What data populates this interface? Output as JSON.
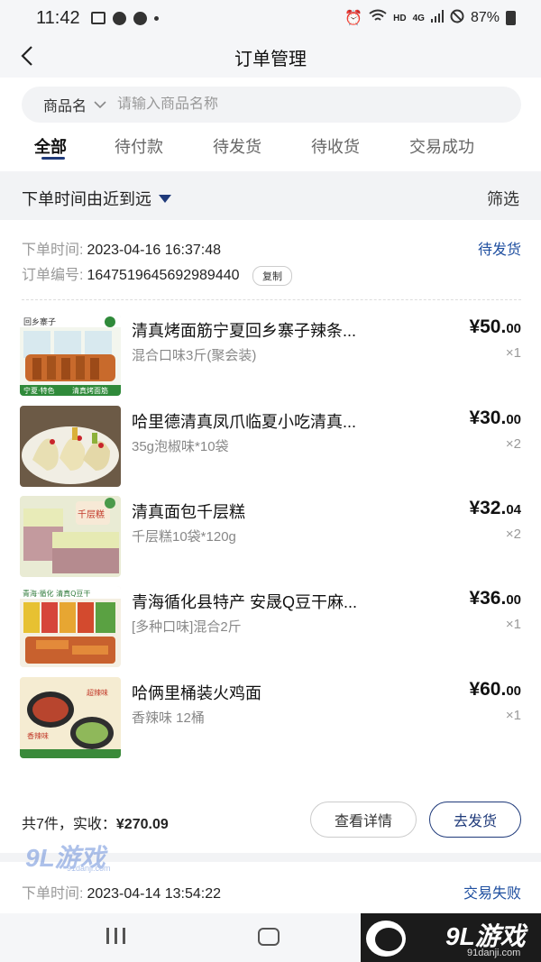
{
  "statusbar": {
    "time": "11:42",
    "hd": "HD",
    "net": "4G",
    "battery": "87%"
  },
  "header": {
    "title": "订单管理"
  },
  "search": {
    "category": "商品名",
    "placeholder": "请输入商品名称"
  },
  "tabs": [
    "全部",
    "待付款",
    "待发货",
    "待收货",
    "交易成功"
  ],
  "sortbar": {
    "sort_label": "下单时间由近到远",
    "filter_label": "筛选"
  },
  "order1": {
    "time_label": "下单时间:",
    "time": "2023-04-16 16:37:48",
    "id_label": "订单编号:",
    "id": "1647519645692989440",
    "copy": "复制",
    "status": "待发货",
    "items": [
      {
        "name": "清真烤面筋宁夏回乡寨子辣条...",
        "spec": "混合口味3斤(聚会装)",
        "price_int": "¥50.",
        "price_dec": "00",
        "qty": "×1"
      },
      {
        "name": "哈里德清真凤爪临夏小吃清真...",
        "spec": "35g泡椒味*10袋",
        "price_int": "¥30.",
        "price_dec": "00",
        "qty": "×2"
      },
      {
        "name": "清真面包千层糕",
        "spec": "千层糕10袋*120g",
        "price_int": "¥32.",
        "price_dec": "04",
        "qty": "×2"
      },
      {
        "name": "青海循化县特产 安晟Q豆干麻...",
        "spec": "[多种口味]混合2斤",
        "price_int": "¥36.",
        "price_dec": "00",
        "qty": "×1"
      },
      {
        "name": "哈俩里桶装火鸡面",
        "spec": "香辣味 12桶",
        "price_int": "¥60.",
        "price_dec": "00",
        "qty": "×1"
      }
    ],
    "summary_prefix": "共7件，实收：",
    "summary_total": "¥270.09",
    "detail_btn": "查看详情",
    "ship_btn": "去发货"
  },
  "order2": {
    "time_label": "下单时间:",
    "time": "2023-04-14 13:54:22",
    "status": "交易失败"
  },
  "thumb_text": {
    "item1_brand": "回乡寨子",
    "item1_tag_left": "宁夏·特色",
    "item1_tag_right": "清真烤面筋",
    "item3_label": "千层糕",
    "item4_top": "青海·循化 清真Q豆干",
    "item5_spicy": "超辣味",
    "item5_mild": "香辣味"
  },
  "watermark": {
    "brand": "9L游戏",
    "site": "91danji.com"
  },
  "colors": {
    "accent": "#1f3a7a",
    "status_blue": "#1f4fa0"
  }
}
